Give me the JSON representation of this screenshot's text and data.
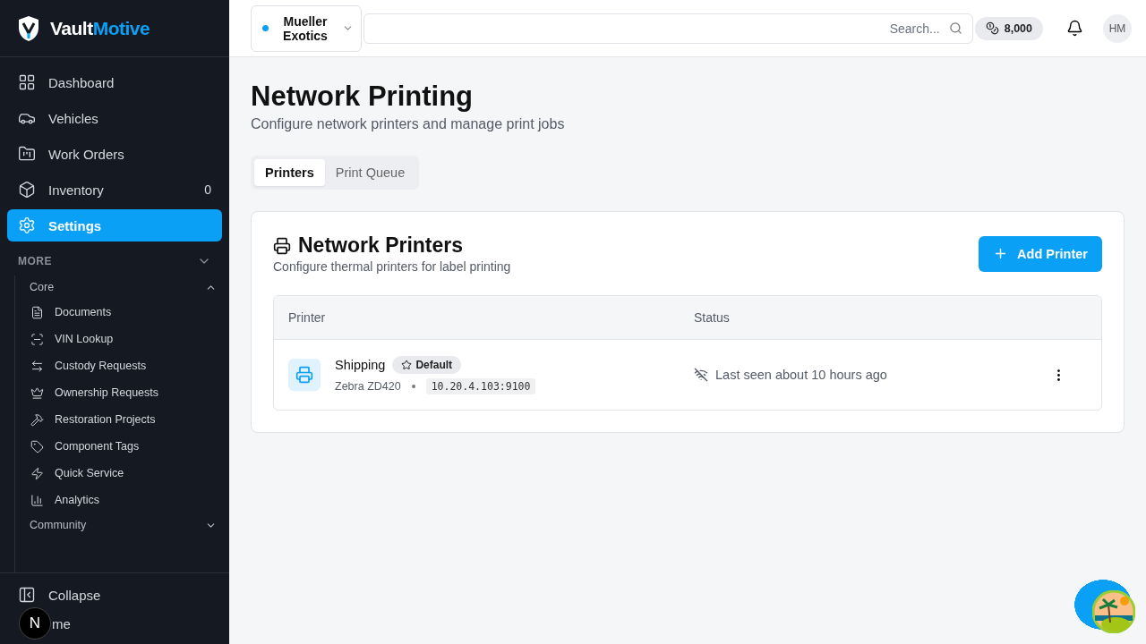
{
  "brand": {
    "first": "Vault",
    "second": "Motive"
  },
  "nav": [
    {
      "kind": "dashboard",
      "label": "Dashboard",
      "selected": false
    },
    {
      "kind": "vehicles",
      "label": "Vehicles",
      "selected": false
    },
    {
      "kind": "orders",
      "label": "Work Orders",
      "selected": false
    },
    {
      "kind": "inventory",
      "label": "Inventory",
      "count": "0",
      "selected": false
    },
    {
      "kind": "settings",
      "label": "Settings",
      "selected": true
    }
  ],
  "more": {
    "label": "MORE",
    "expanded": true,
    "groups": [
      {
        "label": "Core",
        "expanded": true,
        "items": [
          {
            "kind": "documents",
            "label": "Documents"
          },
          {
            "kind": "scan",
            "label": "VIN Lookup"
          },
          {
            "kind": "swap",
            "label": "Custody Requests"
          },
          {
            "kind": "crown",
            "label": "Ownership Requests"
          },
          {
            "kind": "hammer",
            "label": "Restoration Projects"
          },
          {
            "kind": "tag",
            "label": "Component Tags"
          },
          {
            "kind": "zap",
            "label": "Quick Service"
          },
          {
            "kind": "chart",
            "label": "Analytics"
          }
        ]
      },
      {
        "label": "Community",
        "expanded": false
      }
    ]
  },
  "footer": {
    "collapse": "Collapse",
    "theme": "me",
    "badge": "N"
  },
  "topbar": {
    "org": "Mueller Exotics",
    "search": {
      "placeholder": "Search..."
    },
    "credits": "8,000",
    "avatar": "HM"
  },
  "page": {
    "title": "Network Printing",
    "subtitle": "Configure network printers and manage print jobs"
  },
  "tabs": [
    {
      "label": "Printers",
      "selected": true
    },
    {
      "label": "Print Queue",
      "selected": false
    }
  ],
  "card": {
    "title": "Network Printers",
    "subtitle": "Configure thermal printers for label printing",
    "button": "Add Printer"
  },
  "table": {
    "columns": [
      "Printer",
      "Status"
    ],
    "rows": [
      {
        "name": "Shipping",
        "default": true,
        "badge": "Default",
        "model": "Zebra ZD420",
        "address": "10.20.4.103:9100",
        "online": false,
        "status": "Last seen about 10 hours ago"
      }
    ]
  }
}
